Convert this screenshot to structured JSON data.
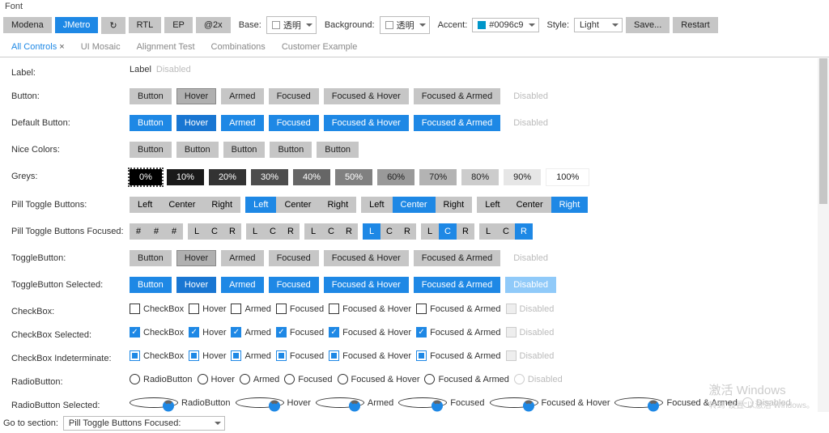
{
  "menubar": {
    "font": "Font"
  },
  "toolbar": {
    "modena": "Modena",
    "jmetro": "JMetro",
    "reload_icon": "↻",
    "rtl": "RTL",
    "ep": "EP",
    "at2x": "@2x",
    "base_label": "Base:",
    "base_value": "透明",
    "bg_label": "Background:",
    "bg_value": "透明",
    "accent_label": "Accent:",
    "accent_value": "#0096c9",
    "style_label": "Style:",
    "style_value": "Light",
    "save": "Save...",
    "restart": "Restart"
  },
  "tabs": {
    "all": "All Controls",
    "mosaic": "UI Mosaic",
    "align": "Alignment Test",
    "combo": "Combinations",
    "cust": "Customer Example"
  },
  "rows": {
    "label": {
      "lab": "Label:",
      "v1": "Label",
      "v2": "Disabled"
    },
    "button": {
      "lab": "Button:",
      "b1": "Button",
      "b2": "Hover",
      "b3": "Armed",
      "b4": "Focused",
      "b5": "Focused & Hover",
      "b6": "Focused & Armed",
      "b7": "Disabled"
    },
    "defbtn": {
      "lab": "Default Button:",
      "b1": "Button",
      "b2": "Hover",
      "b3": "Armed",
      "b4": "Focused",
      "b5": "Focused & Hover",
      "b6": "Focused & Armed",
      "b7": "Disabled"
    },
    "nice": {
      "lab": "Nice Colors:",
      "b1": "Button",
      "b2": "Button",
      "b3": "Button",
      "b4": "Button",
      "b5": "Button"
    },
    "greys": {
      "lab": "Greys:",
      "g0": "0%",
      "g1": "10%",
      "g2": "20%",
      "g3": "30%",
      "g4": "40%",
      "g5": "50%",
      "g6": "60%",
      "g7": "70%",
      "g8": "80%",
      "g9": "90%",
      "g10": "100%"
    },
    "pilltoggle": {
      "lab": "Pill Toggle Buttons:",
      "l": "Left",
      "c": "Center",
      "r": "Right"
    },
    "pillfocus": {
      "lab": "Pill Toggle Buttons Focused:",
      "h": "#",
      "l": "L",
      "c": "C",
      "r": "R"
    },
    "togglebtn": {
      "lab": "ToggleButton:",
      "b1": "Button",
      "b2": "Hover",
      "b3": "Armed",
      "b4": "Focused",
      "b5": "Focused & Hover",
      "b6": "Focused & Armed",
      "b7": "Disabled"
    },
    "togglesel": {
      "lab": "ToggleButton Selected:",
      "b1": "Button",
      "b2": "Hover",
      "b3": "Armed",
      "b4": "Focused",
      "b5": "Focused & Hover",
      "b6": "Focused & Armed",
      "b7": "Disabled"
    },
    "checkbox": {
      "lab": "CheckBox:",
      "c1": "CheckBox",
      "c2": "Hover",
      "c3": "Armed",
      "c4": "Focused",
      "c5": "Focused & Hover",
      "c6": "Focused & Armed",
      "c7": "Disabled"
    },
    "checkboxsel": {
      "lab": "CheckBox Selected:",
      "c1": "CheckBox",
      "c2": "Hover",
      "c3": "Armed",
      "c4": "Focused",
      "c5": "Focused & Hover",
      "c6": "Focused & Armed",
      "c7": "Disabled"
    },
    "checkboxind": {
      "lab": "CheckBox Indeterminate:",
      "c1": "CheckBox",
      "c2": "Hover",
      "c3": "Armed",
      "c4": "Focused",
      "c5": "Focused & Hover",
      "c6": "Focused & Armed",
      "c7": "Disabled"
    },
    "radio": {
      "lab": "RadioButton:",
      "r1": "RadioButton",
      "r2": "Hover",
      "r3": "Armed",
      "r4": "Focused",
      "r5": "Focused & Hover",
      "r6": "Focused & Armed",
      "r7": "Disabled"
    },
    "radiosel": {
      "lab": "RadioButton Selected:",
      "r1": "RadioButton",
      "r2": "Hover",
      "r3": "Armed",
      "r4": "Focused",
      "r5": "Focused & Hover",
      "r6": "Focused & Armed",
      "r7": "Disabled"
    }
  },
  "footer": {
    "goto": "Go to section:",
    "value": "Pill Toggle Buttons Focused:"
  },
  "watermark": {
    "l1": "激活 Windows",
    "l2": "转到\"设置\"以激活 Windows。"
  }
}
